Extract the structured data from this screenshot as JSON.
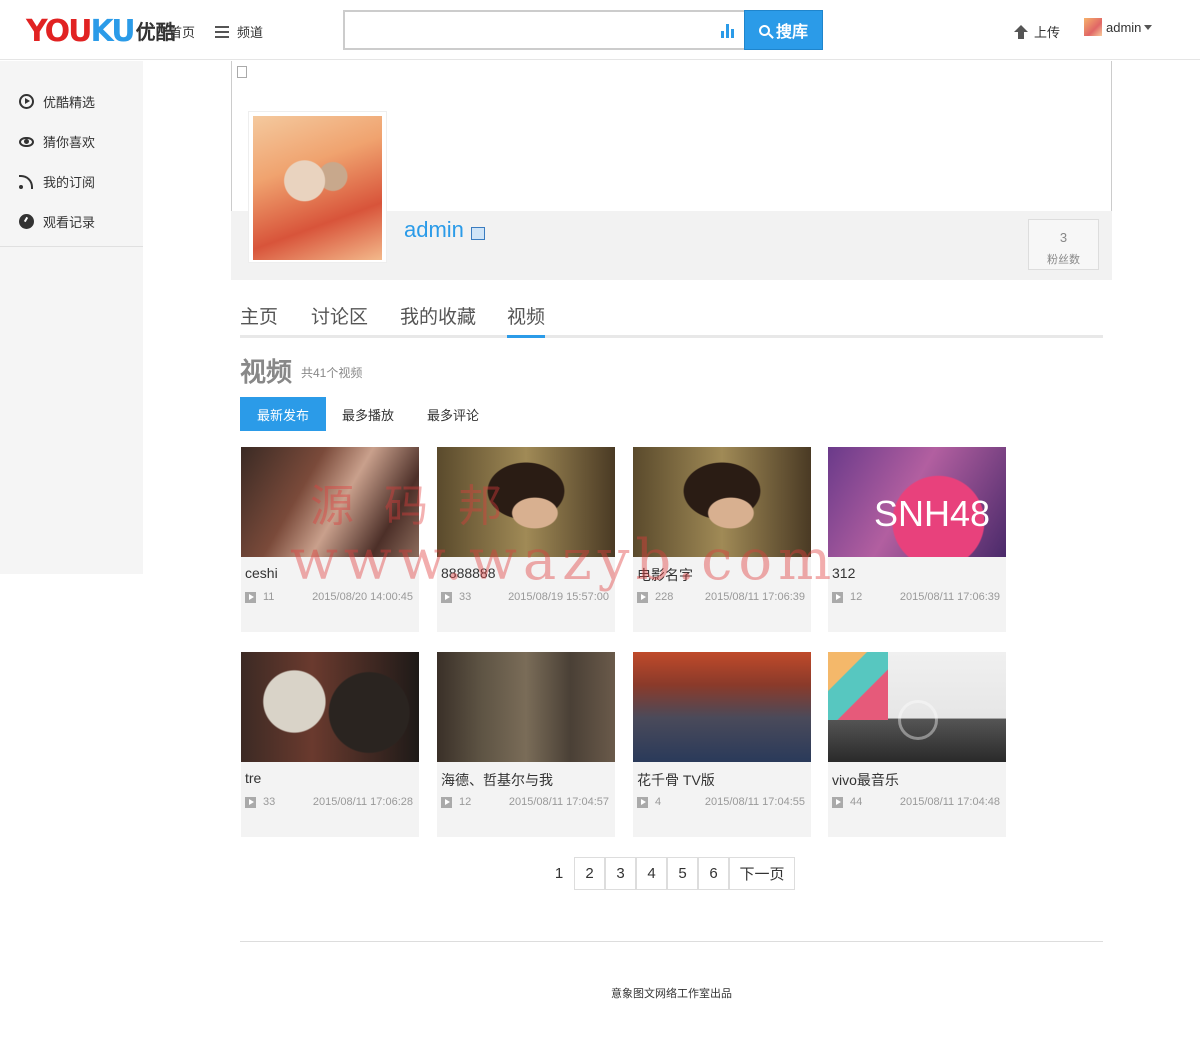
{
  "header": {
    "logo_en": "YOUKU",
    "logo_cn": "优酷",
    "nav_home": "首页",
    "nav_channel": "频道",
    "search_value": "",
    "search_button": "搜库",
    "upload": "上传",
    "user_name": "admin"
  },
  "sidebar": {
    "items": [
      {
        "label": "优酷精选",
        "icon": "play-circle-icon"
      },
      {
        "label": "猜你喜欢",
        "icon": "eye-icon"
      },
      {
        "label": "我的订阅",
        "icon": "rss-icon"
      },
      {
        "label": "观看记录",
        "icon": "clock-icon"
      }
    ]
  },
  "profile": {
    "username": "admin",
    "fans_count": "3",
    "fans_label": "粉丝数"
  },
  "tabs": [
    {
      "label": "主页"
    },
    {
      "label": "讨论区"
    },
    {
      "label": "我的收藏"
    },
    {
      "label": "视频"
    }
  ],
  "videos_section": {
    "title": "视频",
    "count": "共41个视频",
    "sort": [
      "最新发布",
      "最多播放",
      "最多评论"
    ]
  },
  "videos": [
    {
      "title": "ceshi",
      "plays": "11",
      "date": "2015/08/20 14:00:45"
    },
    {
      "title": "8888888",
      "plays": "33",
      "date": "2015/08/19 15:57:00"
    },
    {
      "title": "电影名字",
      "plays": "228",
      "date": "2015/08/11 17:06:39"
    },
    {
      "title": "312",
      "plays": "12",
      "date": "2015/08/11 17:06:39"
    },
    {
      "title": "tre",
      "plays": "33",
      "date": "2015/08/11 17:06:28"
    },
    {
      "title": "海德、哲基尔与我",
      "plays": "12",
      "date": "2015/08/11 17:04:57"
    },
    {
      "title": "花千骨 TV版",
      "plays": "4",
      "date": "2015/08/11 17:04:55"
    },
    {
      "title": "vivo最音乐",
      "plays": "44",
      "date": "2015/08/11 17:04:48"
    }
  ],
  "pagination": {
    "current": "1",
    "pages": [
      "2",
      "3",
      "4",
      "5",
      "6"
    ],
    "next": "下一页"
  },
  "footer": {
    "text": "意象图文网络工作室出品"
  },
  "watermark": {
    "line1": "源码邦",
    "line2": "www.wazyb.com"
  },
  "colors": {
    "accent": "#2b9be8",
    "logo_red": "#e12222"
  }
}
